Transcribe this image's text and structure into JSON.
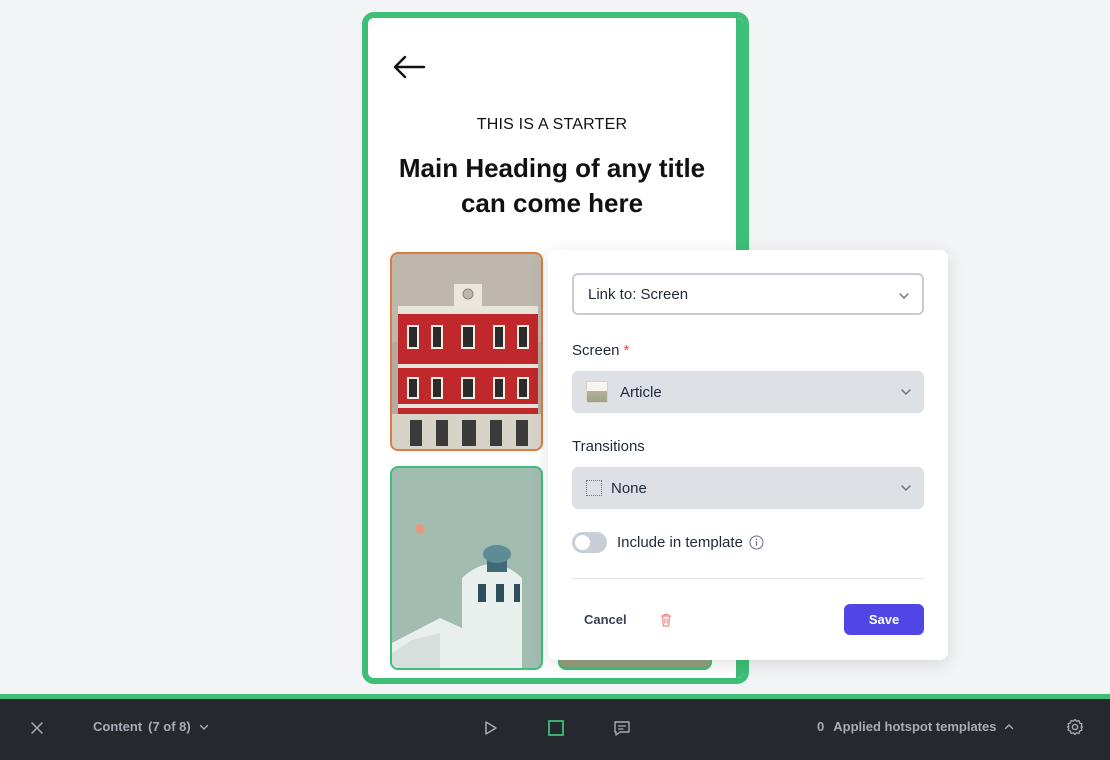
{
  "phone": {
    "eyebrow": "THIS IS A STARTER",
    "heading": "Main Heading of any title can come here"
  },
  "panel": {
    "link_select": "Link to: Screen",
    "screen_label": "Screen",
    "screen_required": "*",
    "screen_value": "Article",
    "transitions_label": "Transitions",
    "transitions_value": "None",
    "include_template_label": "Include in template",
    "include_template_on": false,
    "cancel_label": "Cancel",
    "save_label": "Save"
  },
  "bottombar": {
    "content_label": "Content",
    "content_count": "(7 of 8)",
    "applied_count": "0",
    "applied_label": "Applied hotspot templates"
  },
  "colors": {
    "frame_green": "#3ebf78",
    "accent_orange": "#e07a3f",
    "save_button": "#4f46e5",
    "bottombar_bg": "#25282c"
  },
  "icons": [
    "back-arrow-icon",
    "chevron-down-icon",
    "screen-thumbnail",
    "transition-none-icon",
    "info-icon",
    "trash-icon",
    "close-icon",
    "play-icon",
    "hotspot-square-icon",
    "comment-icon",
    "chevron-up-icon",
    "gear-icon"
  ]
}
